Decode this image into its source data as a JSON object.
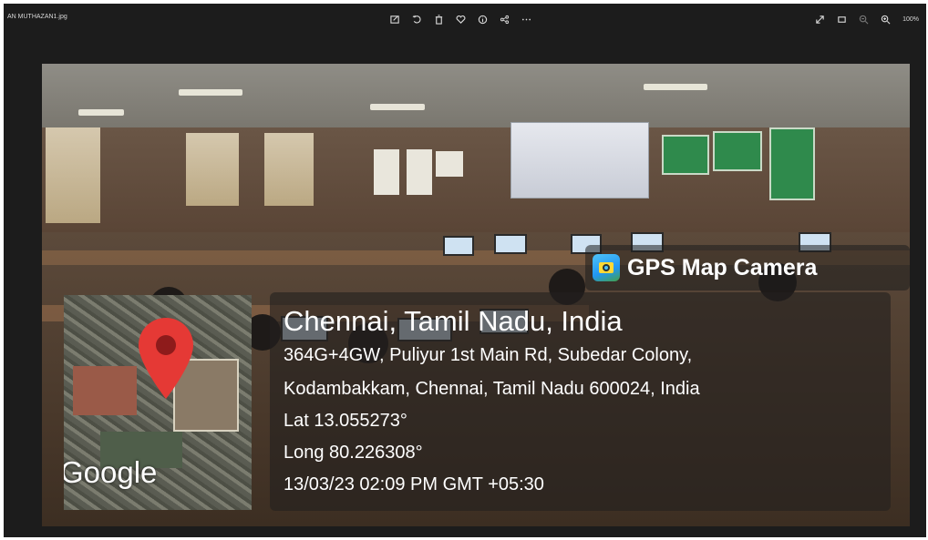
{
  "toolbar": {
    "filename": "AN MUTHAZAN1.jpg",
    "zoom_level": "100%",
    "center_icons": [
      "edit-icon",
      "rotate-icon",
      "delete-icon",
      "favorite-icon",
      "info-icon",
      "share-icon",
      "more-icon"
    ],
    "right_icons": [
      "expand-icon",
      "fit-icon",
      "zoom-out-icon",
      "zoom-in-icon"
    ]
  },
  "overlay": {
    "app_name": "GPS Map Camera",
    "location_title": "Chennai, Tamil Nadu, India",
    "address_line_1": "364G+4GW, Puliyur 1st Main Rd, Subedar Colony,",
    "address_line_2": "Kodambakkam, Chennai, Tamil Nadu 600024, India",
    "latitude": "Lat 13.055273°",
    "longitude": "Long 80.226308°",
    "datetime": "13/03/23 02:09 PM GMT +05:30",
    "map_brand": "Google"
  },
  "colors": {
    "viewer_bg": "#1c1c1c",
    "pin_red": "#e53935",
    "overlay_text": "#ffffff"
  }
}
